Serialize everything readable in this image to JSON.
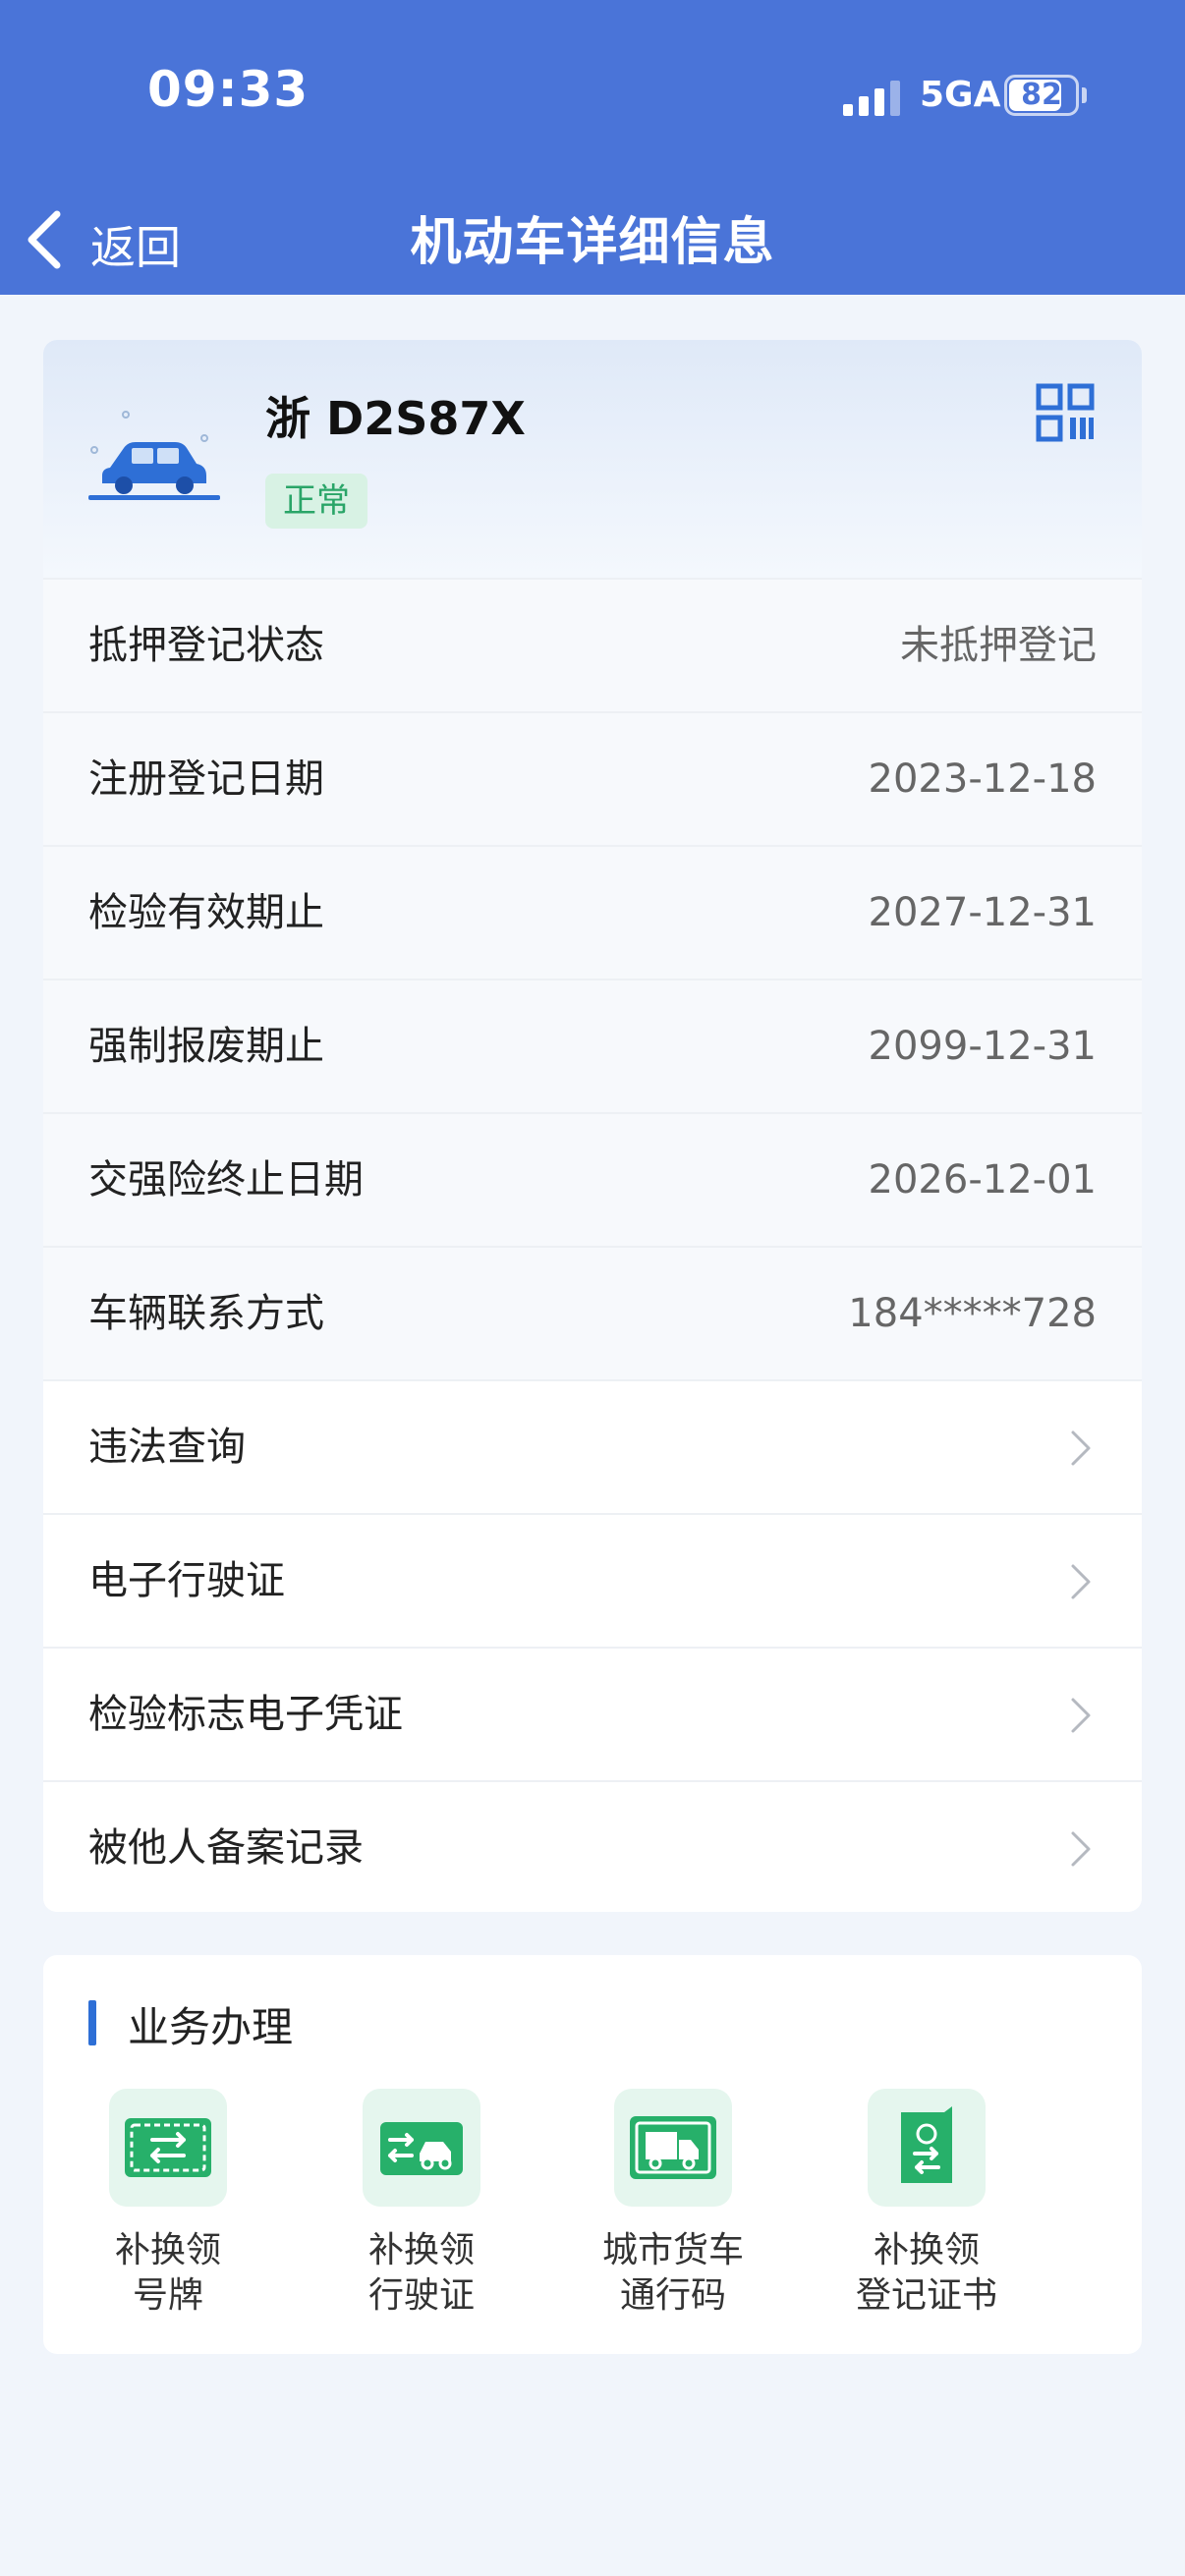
{
  "status_bar": {
    "time": "09:33",
    "network": "5GA",
    "battery": "82",
    "battery_level": 0.82
  },
  "nav": {
    "back_label": "返回",
    "title": "机动车详细信息"
  },
  "vehicle": {
    "plate": "浙 D2S87X",
    "status": "正常"
  },
  "info_rows": [
    {
      "label": "抵押登记状态",
      "value": "未抵押登记"
    },
    {
      "label": "注册登记日期",
      "value": "2023-12-18"
    },
    {
      "label": "检验有效期止",
      "value": "2027-12-31"
    },
    {
      "label": "强制报废期止",
      "value": "2099-12-31"
    },
    {
      "label": "交强险终止日期",
      "value": "2026-12-01"
    },
    {
      "label": "车辆联系方式",
      "value": "184*****728"
    }
  ],
  "link_rows": [
    {
      "label": "违法查询"
    },
    {
      "label": "电子行驶证"
    },
    {
      "label": "检验标志电子凭证"
    },
    {
      "label": "被他人备案记录"
    }
  ],
  "services": {
    "title": "业务办理",
    "items": [
      {
        "line1": "补换领",
        "line2": "号牌",
        "icon": "plate-exchange-icon"
      },
      {
        "line1": "补换领",
        "line2": "行驶证",
        "icon": "license-exchange-icon"
      },
      {
        "line1": "城市货车",
        "line2": "通行码",
        "icon": "truck-pass-icon"
      },
      {
        "line1": "补换领",
        "line2": "登记证书",
        "icon": "certificate-exchange-icon"
      }
    ]
  },
  "colors": {
    "header": "#4a74d8",
    "accent": "#2e6fd6",
    "green": "#2aa568",
    "badge_bg": "#d8f2e4"
  }
}
